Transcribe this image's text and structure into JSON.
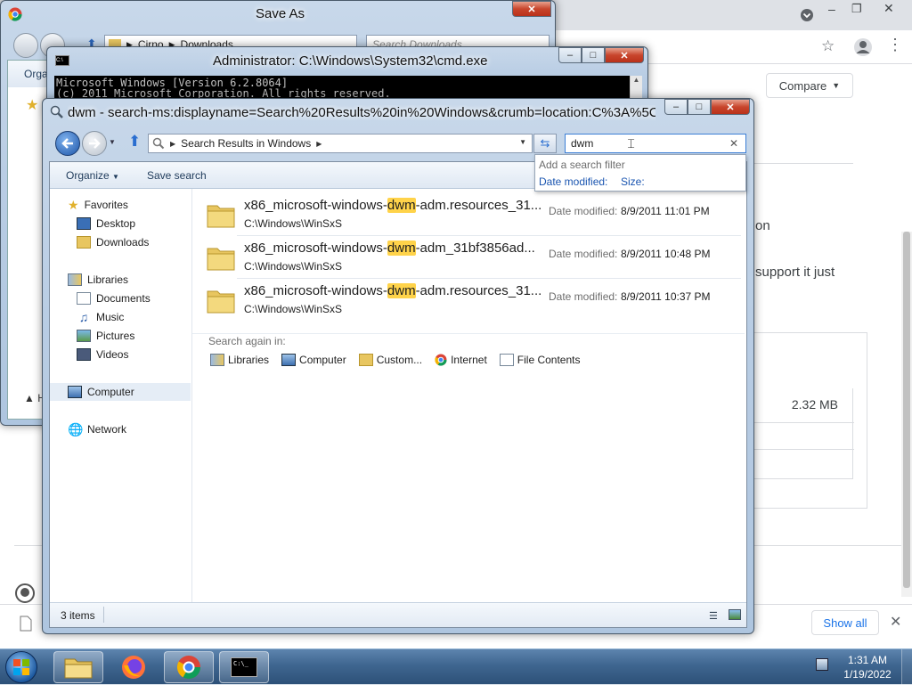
{
  "browser": {
    "compare_label": "Compare",
    "text_fragment_1": "on",
    "text_fragment_2": "support it just",
    "file_size": "2.32 MB",
    "show_all_label": "Show all"
  },
  "saveas": {
    "title": "Save As",
    "breadcrumb": [
      "Cirno",
      "Downloads"
    ],
    "search_placeholder": "Search Downloads",
    "organize_partial": "Orga"
  },
  "cmd": {
    "title": "Administrator: C:\\Windows\\System32\\cmd.exe",
    "lines": [
      "Microsoft Windows [Version 6.2.8064]",
      "(c) 2011 Microsoft Corporation. All rights reserved."
    ]
  },
  "explorer": {
    "title": "dwm - search-ms:displayname=Search%20Results%20in%20Windows&crumb=location:C%3A%5C...",
    "address": "Search Results in Windows",
    "search_value": "dwm",
    "search_dropdown": {
      "hint": "Add a search filter",
      "filters": [
        "Date modified:",
        "Size:"
      ]
    },
    "toolbar": {
      "organize": "Organize",
      "save_search": "Save search"
    },
    "nav": {
      "favorites": "Favorites",
      "desktop": "Desktop",
      "downloads": "Downloads",
      "libraries": "Libraries",
      "documents": "Documents",
      "music": "Music",
      "pictures": "Pictures",
      "videos": "Videos",
      "computer": "Computer",
      "network": "Network"
    },
    "results": [
      {
        "name_pre": "x86_microsoft-windows-",
        "name_hl": "dwm",
        "name_post": "-adm.resources_31...",
        "path": "C:\\Windows\\WinSxS",
        "dm_label": "Date modified:",
        "dm_value": "8/9/2011 11:01 PM"
      },
      {
        "name_pre": "x86_microsoft-windows-",
        "name_hl": "dwm",
        "name_post": "-adm_31bf3856ad...",
        "path": "C:\\Windows\\WinSxS",
        "dm_label": "Date modified:",
        "dm_value": "8/9/2011 10:48 PM"
      },
      {
        "name_pre": "x86_microsoft-windows-",
        "name_hl": "dwm",
        "name_post": "-adm.resources_31...",
        "path": "C:\\Windows\\WinSxS",
        "dm_label": "Date modified:",
        "dm_value": "8/9/2011 10:37 PM"
      }
    ],
    "search_again": {
      "label": "Search again in:",
      "options": [
        "Libraries",
        "Computer",
        "Custom...",
        "Internet",
        "File Contents"
      ]
    },
    "status": "3 items"
  },
  "taskbar": {
    "time": "1:31 AM",
    "date": "1/19/2022"
  }
}
